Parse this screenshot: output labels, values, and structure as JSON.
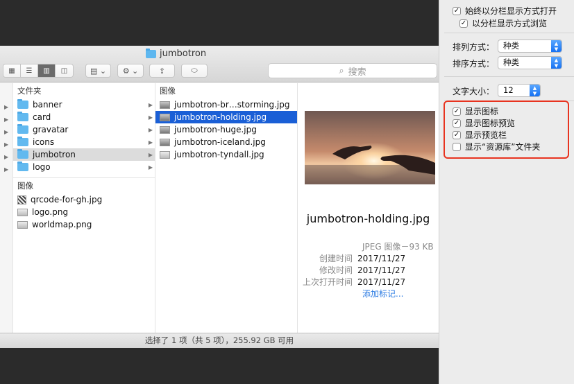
{
  "finder": {
    "title": "jumbotron",
    "search_placeholder": "搜索",
    "col1": {
      "header": "文件夹",
      "folders": [
        {
          "name": "banner"
        },
        {
          "name": "card"
        },
        {
          "name": "gravatar"
        },
        {
          "name": "icons"
        },
        {
          "name": "jumbotron"
        },
        {
          "name": "logo"
        }
      ],
      "images_header": "图像",
      "images": [
        {
          "name": "qrcode-for-gh.jpg"
        },
        {
          "name": "logo.png"
        },
        {
          "name": "worldmap.png"
        }
      ]
    },
    "col2": {
      "header": "图像",
      "files": [
        {
          "name": "jumbotron-br…storming.jpg"
        },
        {
          "name": "jumbotron-holding.jpg"
        },
        {
          "name": "jumbotron-huge.jpg"
        },
        {
          "name": "jumbotron-iceland.jpg"
        },
        {
          "name": "jumbotron-tyndall.jpg"
        }
      ]
    },
    "preview": {
      "filename": "jumbotron-holding.jpg",
      "kind": "JPEG 图像－93 KB",
      "meta": [
        {
          "label": "创建时间",
          "value": "2017/11/27"
        },
        {
          "label": "修改时间",
          "value": "2017/11/27"
        },
        {
          "label": "上次打开时间",
          "value": "2017/11/27"
        }
      ],
      "add_tags": "添加标记..."
    },
    "status": "选择了 1 项（共 5 项），255.92 GB 可用"
  },
  "panel": {
    "always_columns": "始终以分栏显示方式打开",
    "browse_columns": "以分栏显示方式浏览",
    "arrange_label": "排列方式：",
    "arrange_value": "种类",
    "sort_label": "排序方式：",
    "sort_value": "种类",
    "text_size_label": "文字大小：",
    "text_size_value": "12",
    "show_icons": "显示图标",
    "show_icon_preview": "显示图标预览",
    "show_preview_column": "显示预览栏",
    "show_library": "显示“资源库”文件夹"
  },
  "colors": {
    "selection_blue": "#1a5fd6",
    "highlight_red": "#e8331f",
    "link_blue": "#2a7ae2"
  }
}
